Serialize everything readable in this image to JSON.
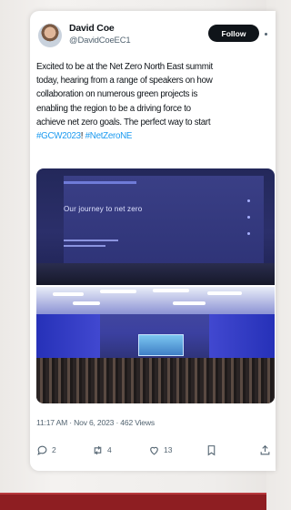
{
  "post": {
    "author_name": "David Coe",
    "author_handle": "@DavidCoeEC1",
    "follow_label": "Follow",
    "text_lines": [
      "Excited to be at the Net Zero North East summit",
      "today, hearing from a range of speakers on how",
      "collaboration on numerous green projects is",
      "enabling the region to be a driving force to",
      "achieve net zero goals. The perfect way to start"
    ],
    "hashtag_1": "#GCW2023",
    "hashtag_sep": "! ",
    "hashtag_2": "#NetZeroNE",
    "slide_title": "Our journey to net zero",
    "meta": "11:17 AM · Nov 6, 2023 · 462 Views",
    "actions": {
      "reply_count": "2",
      "retweet_count": "4",
      "like_count": "13"
    }
  },
  "colors": {
    "link": "#1d9bf0",
    "muted": "#536471",
    "follow_bg": "#0f1419",
    "bottom_bar": "#8e1e22"
  },
  "icons": [
    "more-icon",
    "reply-icon",
    "retweet-icon",
    "like-icon",
    "bookmark-icon",
    "share-icon"
  ]
}
